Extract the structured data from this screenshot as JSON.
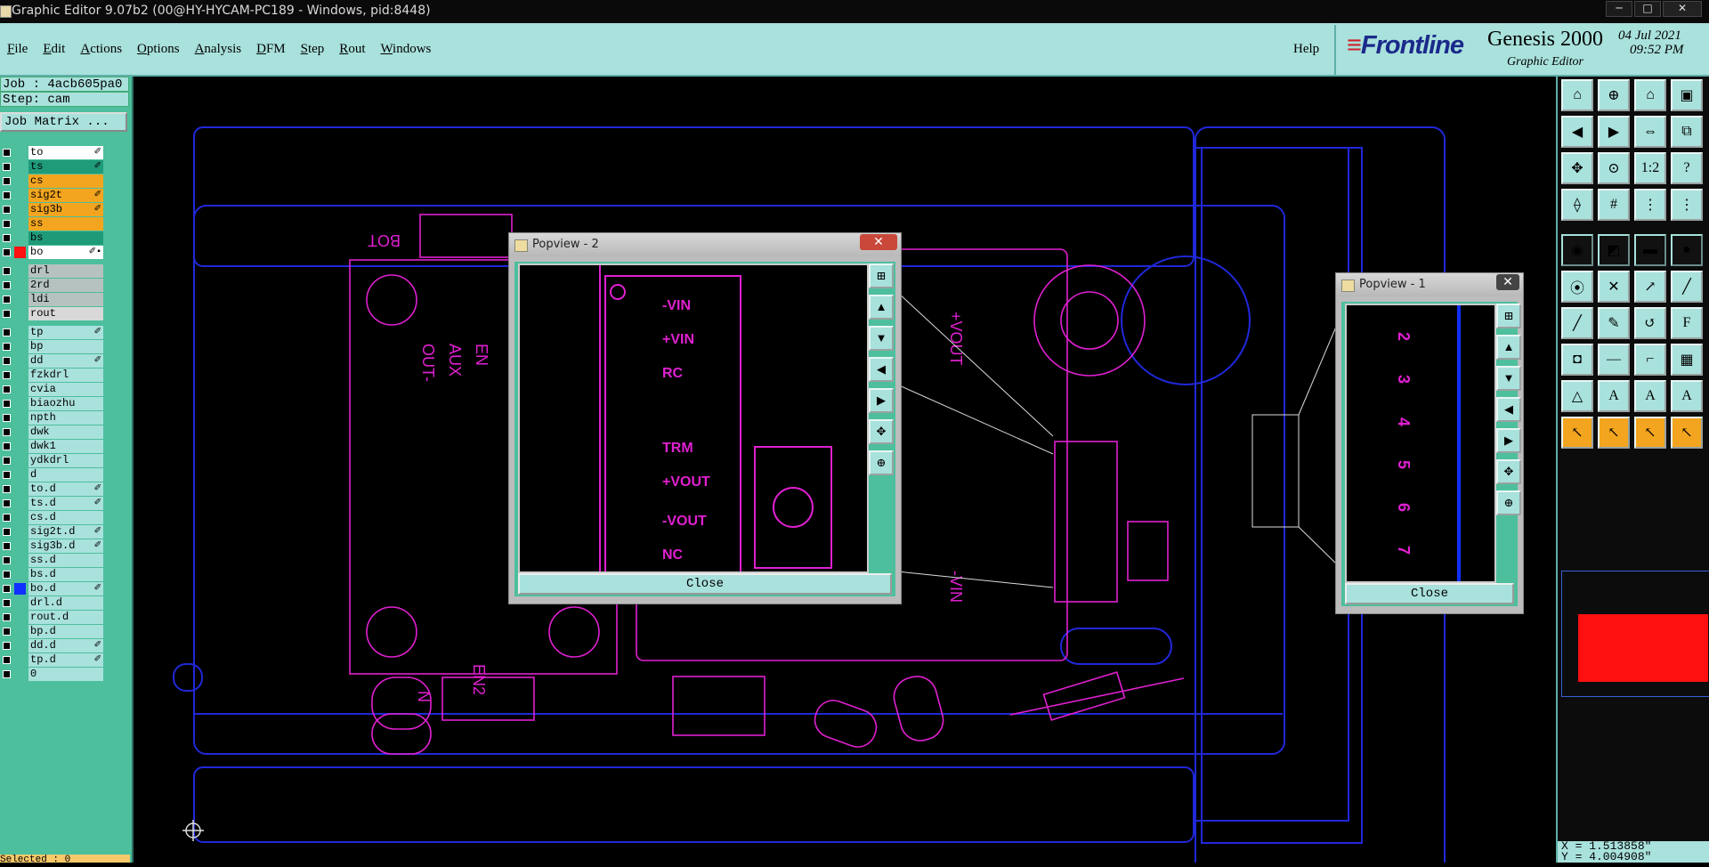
{
  "window": {
    "title": "Graphic Editor 9.07b2 (00@HY-HYCAM-PC189 - Windows, pid:8448)",
    "min": "─",
    "max": "□",
    "close": "✕"
  },
  "menu": [
    "File",
    "Edit",
    "Actions",
    "Options",
    "Analysis",
    "DFM",
    "Step",
    "Rout",
    "Windows"
  ],
  "help": "Help",
  "brand": {
    "logo": "Frontline",
    "product": "Genesis 2000",
    "subtitle": "Graphic Editor",
    "date": "04 Jul 2021",
    "time": "09:52 PM"
  },
  "job": {
    "job": "Job : 4acb605pa0",
    "step": "Step: cam",
    "matrix": "Job Matrix ..."
  },
  "layers": [
    {
      "name": "to",
      "bg": "#ffffff",
      "flag": "✐",
      "swatch": ""
    },
    {
      "name": "ts",
      "bg": "#1f9b7a",
      "flag": "✐",
      "swatch": ""
    },
    {
      "name": "cs",
      "bg": "#f3a51f",
      "flag": "",
      "swatch": ""
    },
    {
      "name": "sig2t",
      "bg": "#f3a51f",
      "flag": "✐",
      "swatch": ""
    },
    {
      "name": "sig3b",
      "bg": "#f3a51f",
      "flag": "✐",
      "swatch": ""
    },
    {
      "name": "ss",
      "bg": "#f3a51f",
      "flag": "",
      "swatch": ""
    },
    {
      "name": "bs",
      "bg": "#1f9b7a",
      "flag": "",
      "swatch": ""
    },
    {
      "name": "bo",
      "bg": "#ffffff",
      "flag": "✐▪",
      "swatch": "#ff1010"
    },
    {
      "name": "drl",
      "bg": "#b5c2c0",
      "flag": "",
      "swatch": ""
    },
    {
      "name": "2rd",
      "bg": "#b5c2c0",
      "flag": "",
      "swatch": ""
    },
    {
      "name": "ldi",
      "bg": "#b5c2c0",
      "flag": "",
      "swatch": ""
    },
    {
      "name": "rout",
      "bg": "#d8d8d8",
      "flag": "",
      "swatch": ""
    },
    {
      "name": "tp",
      "bg": "#a9e1dc",
      "flag": "✐",
      "swatch": ""
    },
    {
      "name": "bp",
      "bg": "#a9e1dc",
      "flag": "",
      "swatch": ""
    },
    {
      "name": "dd",
      "bg": "#a9e1dc",
      "flag": "✐",
      "swatch": ""
    },
    {
      "name": "fzkdrl",
      "bg": "#a9e1dc",
      "flag": "",
      "swatch": ""
    },
    {
      "name": "cvia",
      "bg": "#a9e1dc",
      "flag": "",
      "swatch": ""
    },
    {
      "name": "biaozhu",
      "bg": "#a9e1dc",
      "flag": "",
      "swatch": ""
    },
    {
      "name": "npth",
      "bg": "#a9e1dc",
      "flag": "",
      "swatch": ""
    },
    {
      "name": "dwk",
      "bg": "#a9e1dc",
      "flag": "",
      "swatch": ""
    },
    {
      "name": "dwk1",
      "bg": "#a9e1dc",
      "flag": "",
      "swatch": ""
    },
    {
      "name": "ydkdrl",
      "bg": "#a9e1dc",
      "flag": "",
      "swatch": ""
    },
    {
      "name": "d",
      "bg": "#a9e1dc",
      "flag": "",
      "swatch": ""
    },
    {
      "name": "to.d",
      "bg": "#a9e1dc",
      "flag": "✐",
      "swatch": ""
    },
    {
      "name": "ts.d",
      "bg": "#a9e1dc",
      "flag": "✐",
      "swatch": ""
    },
    {
      "name": "cs.d",
      "bg": "#a9e1dc",
      "flag": "",
      "swatch": ""
    },
    {
      "name": "sig2t.d",
      "bg": "#a9e1dc",
      "flag": "✐",
      "swatch": ""
    },
    {
      "name": "sig3b.d",
      "bg": "#a9e1dc",
      "flag": "✐",
      "swatch": ""
    },
    {
      "name": "ss.d",
      "bg": "#a9e1dc",
      "flag": "",
      "swatch": ""
    },
    {
      "name": "bs.d",
      "bg": "#a9e1dc",
      "flag": "",
      "swatch": ""
    },
    {
      "name": "bo.d",
      "bg": "#a9e1dc",
      "flag": "✐",
      "swatch": "#1030ff"
    },
    {
      "name": "drl.d",
      "bg": "#a9e1dc",
      "flag": "",
      "swatch": ""
    },
    {
      "name": "rout.d",
      "bg": "#a9e1dc",
      "flag": "",
      "swatch": ""
    },
    {
      "name": "bp.d",
      "bg": "#a9e1dc",
      "flag": "",
      "swatch": ""
    },
    {
      "name": "dd.d",
      "bg": "#a9e1dc",
      "flag": "✐",
      "swatch": ""
    },
    {
      "name": "tp.d",
      "bg": "#a9e1dc",
      "flag": "✐",
      "swatch": ""
    },
    {
      "name": "0",
      "bg": "#a9e1dc",
      "flag": "",
      "swatch": ""
    }
  ],
  "status": "Selected : 0",
  "coords": {
    "x": "X = 1.513858\"",
    "y": "Y = 4.004908\""
  },
  "popups": {
    "p2": {
      "title": "Popview - 2",
      "close_label": "Close",
      "close_x": "✕"
    },
    "p1": {
      "title": "Popview - 1",
      "close_label": "Close",
      "close_x": "✕"
    }
  },
  "board_text": {
    "bot": "BOT",
    "out": "OUT-",
    "aux": "AUX",
    "en": "EN",
    "en2": "EN2",
    "n": "N",
    "vout_plus": "+VOUT",
    "vin_minus": "-VIN",
    "vin_m": "-VIN",
    "vin_p": "+VIN",
    "rc": "RC",
    "trm": "TRM",
    "vout_p": "+VOUT",
    "vout_m": "-VOUT",
    "nc": "NC",
    "p1_labels": [
      "2",
      "3",
      "4",
      "5",
      "6",
      "7"
    ]
  },
  "colors": {
    "board_outline": "#2028d8",
    "silk": "#e020d0",
    "panel": "#4dbf9d",
    "button": "#a9e1dc",
    "menubar": "#a9e1dc"
  },
  "tools": [
    "home-icon",
    "zoom-in-icon",
    "house-icon",
    "window-icon",
    "pan-left-icon",
    "pan-right-icon",
    "fit-icon",
    "split-icon",
    "zoom-fit-icon",
    "zoom-center-icon",
    "scale-1-2-icon",
    "help-icon",
    "measure-icon",
    "grid-icon",
    "snap-icon",
    "snap-alt-icon",
    "feature-icon",
    "layer-icon",
    "ruler-icon",
    "circle-icon",
    "connect-icon",
    "cross-icon",
    "arrow-icon",
    "line-icon",
    "slash-icon",
    "edit-icon",
    "arc-icon",
    "font-icon",
    "pad-icon",
    "dash-icon",
    "route-icon",
    "array-icon",
    "triangle-icon",
    "triangle2-icon",
    "triangle3-icon",
    "triangle4-icon",
    "pointer-icon",
    "pointer2-icon",
    "pointer3-icon",
    "pointer4-icon"
  ]
}
